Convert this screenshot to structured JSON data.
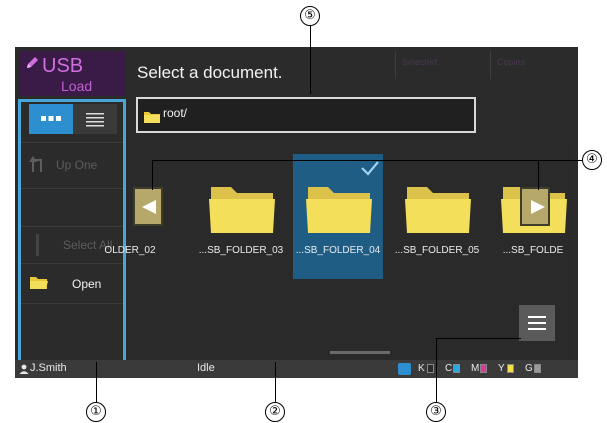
{
  "callouts": [
    "⑤",
    "④",
    "①",
    "②",
    "③"
  ],
  "app": {
    "title": "USB",
    "subtitle": "Load",
    "icon": "pencil-icon"
  },
  "header": {
    "message": "Select a document.",
    "selected_label": "Selected:",
    "copies_label": "Copies"
  },
  "path": {
    "value": "root/",
    "icon": "folder-icon"
  },
  "view_toggle": {
    "grid": "grid-view-icon",
    "list": "list-view-icon",
    "active": "grid"
  },
  "left_panel": {
    "up_one": "Up One",
    "select_all": "Select All",
    "open": "Open"
  },
  "folders": [
    {
      "name": "OLDER_02",
      "selected": false
    },
    {
      "name": "...SB_FOLDER_03",
      "selected": false
    },
    {
      "name": "...SB_FOLDER_04",
      "selected": true
    },
    {
      "name": "...SB_FOLDER_05",
      "selected": false
    },
    {
      "name": "...SB_FOLDE",
      "selected": false
    }
  ],
  "status": {
    "user": "J.Smith",
    "state": "Idle",
    "toner": [
      "K",
      "C",
      "M",
      "Y",
      "G"
    ]
  },
  "colors": {
    "accent": "#4aa8d8",
    "selected_tile": "#1f5d85",
    "folder": "#f4df5a",
    "cyan": "#2aa8e0",
    "magenta": "#d93a9a",
    "yellow": "#f5e04a",
    "gray": "#9a9a9a"
  }
}
